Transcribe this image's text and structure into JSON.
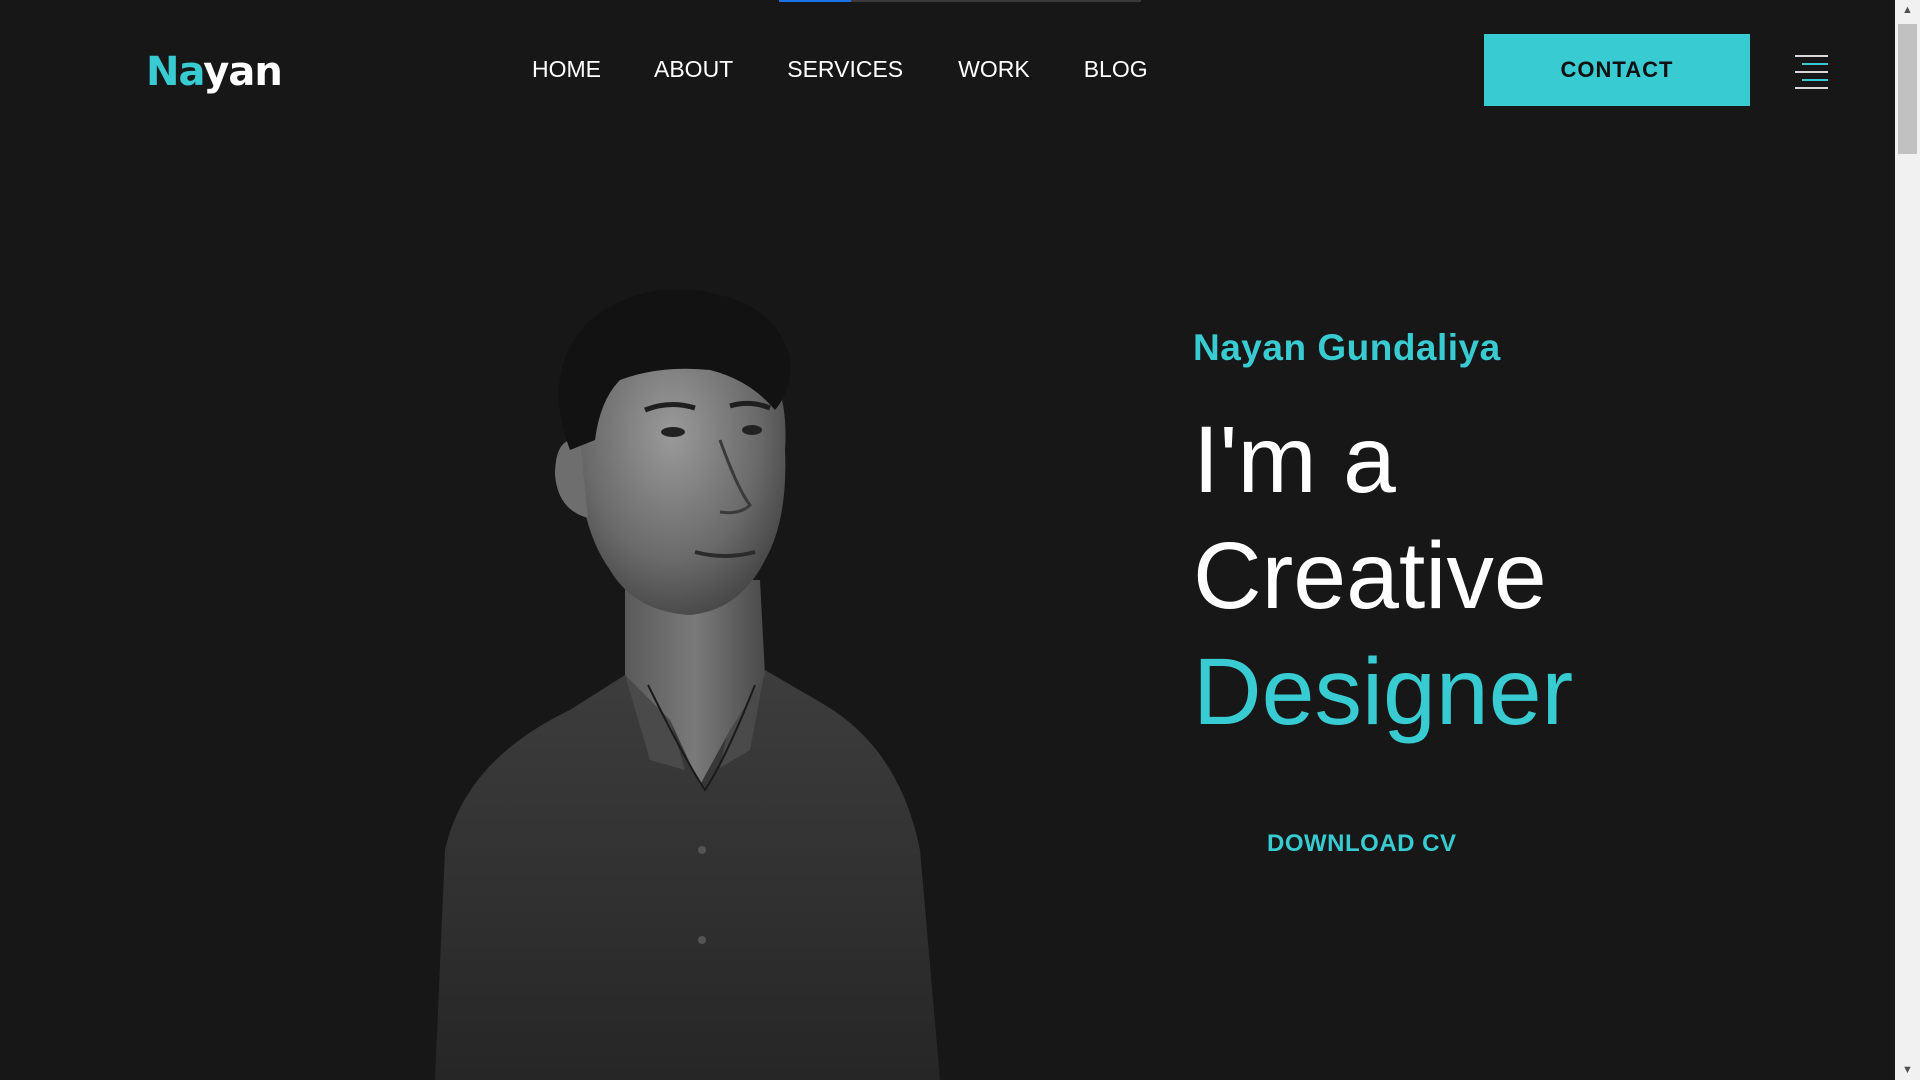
{
  "header": {
    "logo": {
      "part1": "N",
      "part2": "a",
      "part3": "yan"
    },
    "nav": [
      {
        "label": "HOME"
      },
      {
        "label": "ABOUT"
      },
      {
        "label": "SERVICES"
      },
      {
        "label": "WORK"
      },
      {
        "label": "BLOG"
      }
    ],
    "contact_label": "CONTACT",
    "menu_icon": "hamburger-menu-icon"
  },
  "hero": {
    "name": "Nayan Gundaliya",
    "line1": "I'm a",
    "line2": "Creative",
    "line3": "Designer",
    "download_label": "DOWNLOAD CV",
    "portrait_icon": "portrait-photo"
  },
  "colors": {
    "background": "#171717",
    "accent": "#38cbd1",
    "text": "#ffffff",
    "loading": "#1a73e8"
  },
  "loading_bar": {
    "progress": 0.2
  }
}
